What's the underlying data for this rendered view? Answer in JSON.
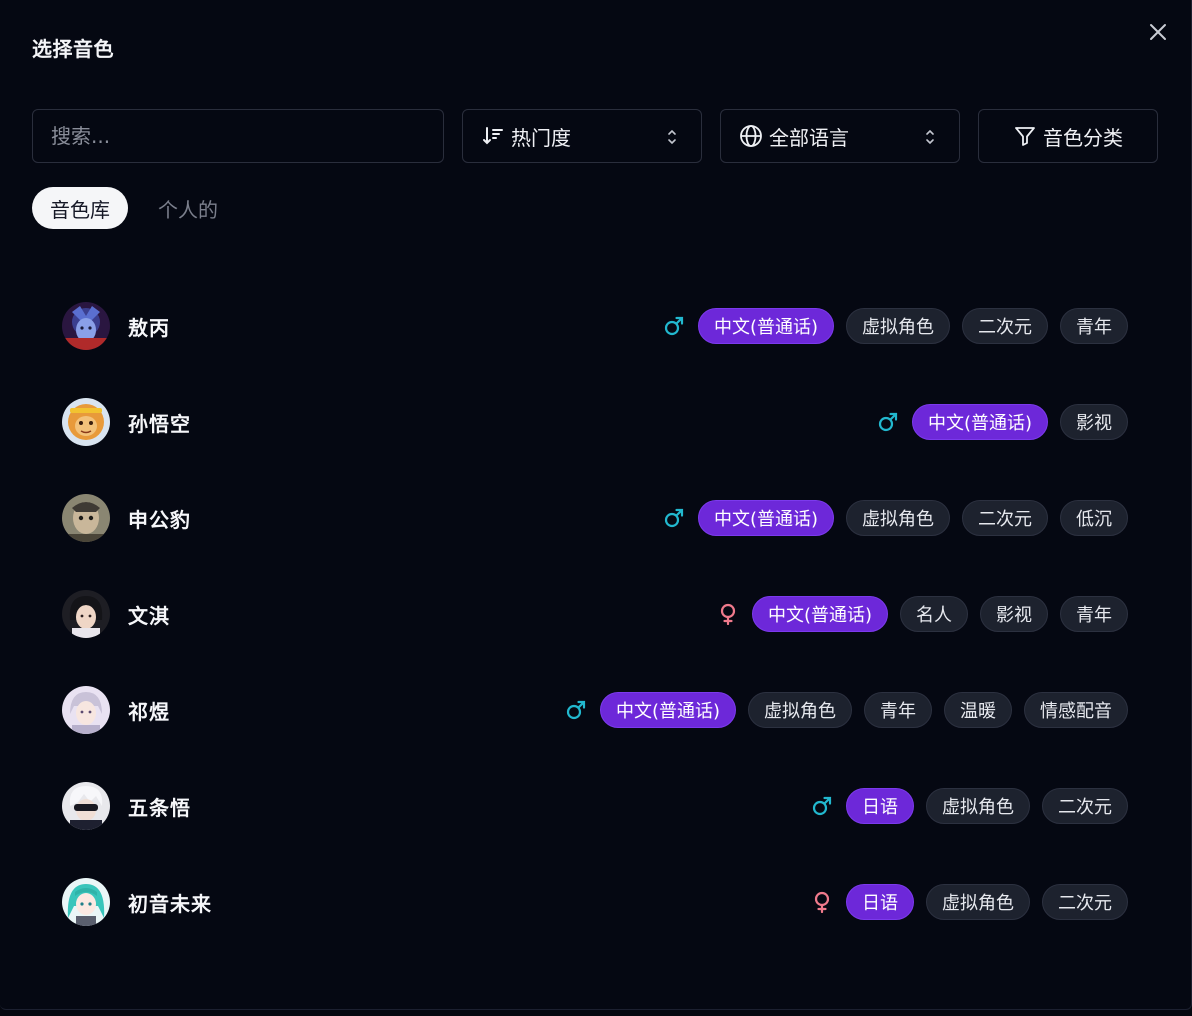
{
  "dialog": {
    "title": "选择音色"
  },
  "toolbar": {
    "search_placeholder": "搜索...",
    "sort_label": "热门度",
    "language_label": "全部语言",
    "category_label": "音色分类"
  },
  "tabs": [
    {
      "label": "音色库",
      "active": true
    },
    {
      "label": "个人的",
      "active": false
    }
  ],
  "colors": {
    "language_tag": "#6d28d9",
    "male_icon": "#22b8cf",
    "female_icon": "#f07a8c"
  },
  "voices": [
    {
      "name": "敖丙",
      "gender": "male",
      "language": "中文(普通话)",
      "tags": [
        "虚拟角色",
        "二次元",
        "青年"
      ],
      "avatar": "avatar-aobing"
    },
    {
      "name": "孙悟空",
      "gender": "male",
      "language": "中文(普通话)",
      "tags": [
        "影视"
      ],
      "avatar": "avatar-sunwukong"
    },
    {
      "name": "申公豹",
      "gender": "male",
      "language": "中文(普通话)",
      "tags": [
        "虚拟角色",
        "二次元",
        "低沉"
      ],
      "avatar": "avatar-shengongbao"
    },
    {
      "name": "文淇",
      "gender": "female",
      "language": "中文(普通话)",
      "tags": [
        "名人",
        "影视",
        "青年"
      ],
      "avatar": "avatar-wenqi"
    },
    {
      "name": "祁煜",
      "gender": "male",
      "language": "中文(普通话)",
      "tags": [
        "虚拟角色",
        "青年",
        "温暖",
        "情感配音"
      ],
      "avatar": "avatar-qiyu"
    },
    {
      "name": "五条悟",
      "gender": "male",
      "language": "日语",
      "tags": [
        "虚拟角色",
        "二次元"
      ],
      "avatar": "avatar-gojo"
    },
    {
      "name": "初音未来",
      "gender": "female",
      "language": "日语",
      "tags": [
        "虚拟角色",
        "二次元"
      ],
      "avatar": "avatar-miku"
    }
  ]
}
